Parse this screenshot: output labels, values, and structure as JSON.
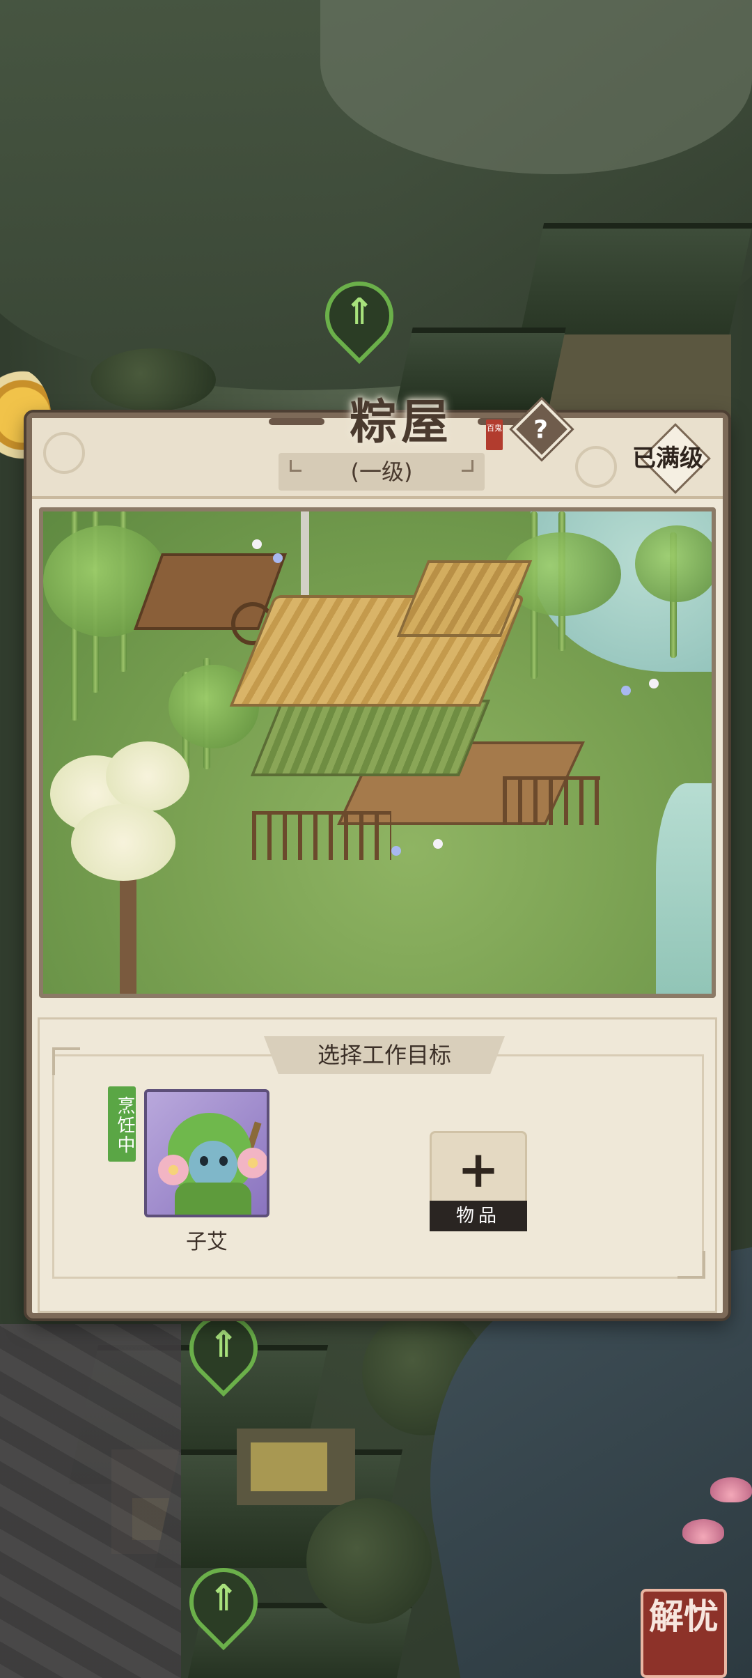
{
  "building": {
    "name": "粽屋",
    "level": "(一级)",
    "status": "已满级",
    "help_icon": "question-icon",
    "seal_text": "百鬼"
  },
  "work_panel": {
    "title": "选择工作目标",
    "character": {
      "name": "子艾",
      "status_tag": "烹饪中"
    },
    "item_slot": {
      "icon": "plus-icon",
      "label": "物品"
    }
  },
  "map": {
    "upgrade_icon": "upgrade-arrow-icon",
    "corner_badge": "解忧"
  },
  "colors": {
    "panel_bg": "#efe8d8",
    "panel_border": "#7d6a58",
    "status_green": "#5aa645",
    "title_text": "#4a3a2e"
  }
}
